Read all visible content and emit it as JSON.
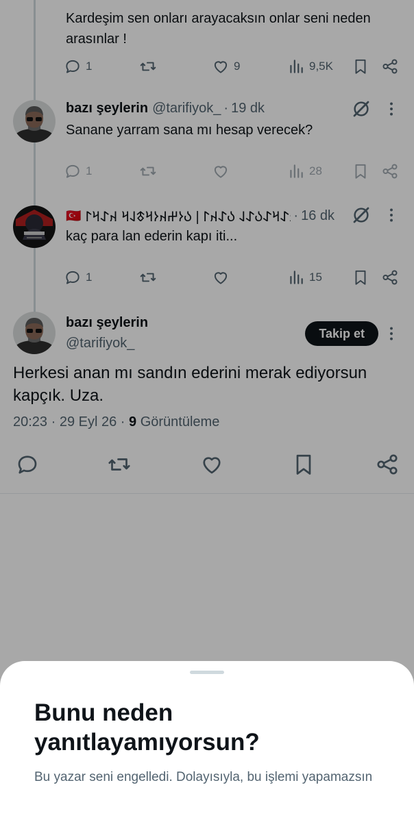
{
  "thread": {
    "prev_tweet": {
      "text": "Kardeşim sen onları arayacaksın onlar seni neden arasınlar !",
      "replies": "1",
      "likes": "9",
      "views": "9,5K"
    },
    "tweet1": {
      "name": "bazı şeylerin",
      "handle": "@tarifiyok_",
      "time": "19 dk",
      "text": "Sanane yarram sana mı hesap verecek?",
      "replies": "1",
      "views": "28"
    },
    "tweet2": {
      "flag": "🇹🇷",
      "name": "𐰴𐰀𐰺𐰀𐰉𐰀𐰞 𐰉𐰀𐰴𐰃 | 𐰉𐰆𐰔𐰴𐰆𐰺𐱃𐰞𐰺 𐰴𐰀𐰺𐰃 ..",
      "time": "16 dk",
      "text": "kaç para lan ederin kapı iti...",
      "replies": "1",
      "views": "15"
    },
    "main": {
      "name": "bazı şeylerin",
      "handle": "@tarifiyok_",
      "follow_label": "Takip et",
      "text": "Herkesi anan mı sandın ederini merak ediyorsun kapçık. Uza.",
      "time": "20:23",
      "date": "29 Eyl 26",
      "views_count": "9",
      "views_label": "Görüntüleme"
    }
  },
  "sheet": {
    "title": "Bunu neden yanıtlayamıyorsun?",
    "description": "Bu yazar seni engelledi. Dolayısıyla, bu işlemi yapamazsın"
  },
  "icons": [
    "reply-icon",
    "retweet-icon",
    "like-icon",
    "views-icon",
    "bookmark-icon",
    "share-icon",
    "grok-icon",
    "more-icon"
  ],
  "colors": {
    "text": "#0f1419",
    "secondary": "#536471",
    "button_bg": "#0f1419",
    "sheet_bg": "#ffffff"
  }
}
